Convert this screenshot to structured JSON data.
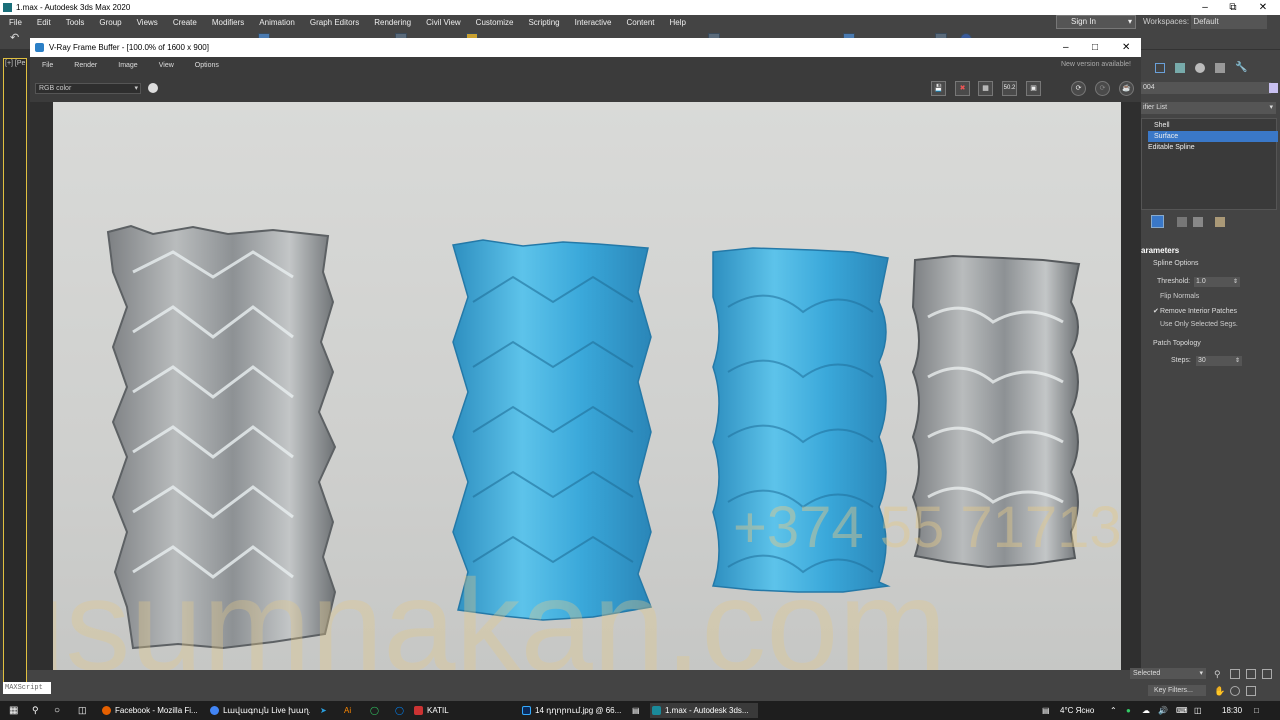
{
  "titlebar": {
    "title": "1.max - Autodesk 3ds Max 2020"
  },
  "menubar": {
    "items": [
      "File",
      "Edit",
      "Tools",
      "Group",
      "Views",
      "Create",
      "Modifiers",
      "Animation",
      "Graph Editors",
      "Rendering",
      "Civil View",
      "Customize",
      "Scripting",
      "Interactive",
      "Content",
      "Help"
    ],
    "signin": "Sign In",
    "workspaces_label": "Workspaces:",
    "workspaces_value": "Default"
  },
  "viewport": {
    "label": "[+] [Pe"
  },
  "vfb": {
    "title": "V-Ray Frame Buffer - [100.0% of 1600 x 900]",
    "menu": [
      "File",
      "Render",
      "Image",
      "View",
      "Options"
    ],
    "new_version": "New version available!",
    "channel": "RGB color",
    "zoom_badge": "50.2",
    "watermark_domain": "usumnakan.com",
    "watermark_phone": "+374 55 71713"
  },
  "cmdpanel": {
    "object_name": "004",
    "modifier_list": "ifier List",
    "stack": [
      "Shell",
      "Surface",
      "Editable Spline"
    ],
    "selected_stack_index": 1,
    "rollout_title": "arameters",
    "spline_options": "Spline Options",
    "threshold_label": "Threshold:",
    "threshold_value": "1.0",
    "flip_normals": "Flip Normals",
    "flip_normals_checked": false,
    "remove_interior": "Remove Interior Patches",
    "remove_interior_checked": true,
    "use_only_selected": "Use Only Selected Segs.",
    "use_only_selected_checked": false,
    "patch_topology": "Patch Topology",
    "steps_label": "Steps:",
    "steps_value": "30"
  },
  "status": {
    "maxscript": "MAXScript",
    "selected": "Selected",
    "key_filters": "Key Filters..."
  },
  "taskbar": {
    "tasks": [
      "Facebook - Mozilla Fi...",
      "Լավագույն Live խաղ...",
      "KATIL",
      "14 դղորում.jpg @ 66...",
      "1.max - Autodesk 3ds..."
    ],
    "weather": "4°C Ясно",
    "time": "18:30"
  },
  "colors": {
    "blue_vase": "#4fb3dd",
    "accent_sel": "#3a78c8",
    "viewport_border": "#e0c040"
  }
}
